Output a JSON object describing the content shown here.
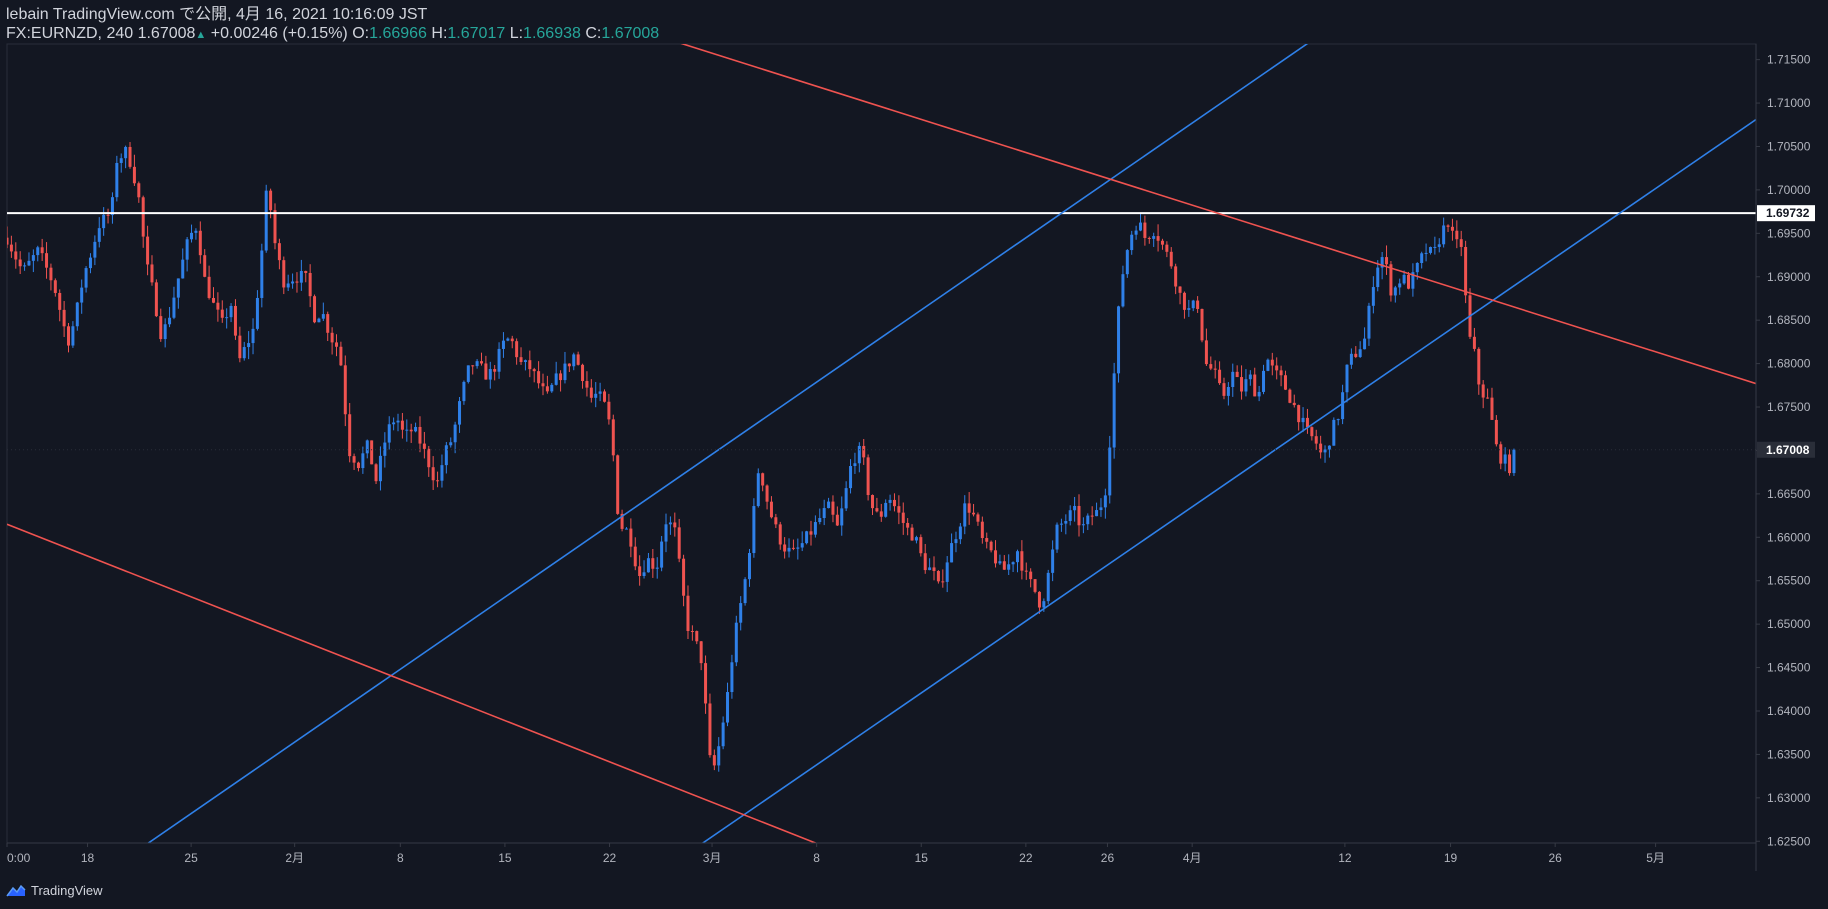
{
  "header": {
    "line1": "lebain TradingView.com で公開, 4月 16, 2021 10:16:09 JST",
    "symbol_info": "FX:EURNZD, 240 1.67008",
    "change_arrow": "▲",
    "change": "+0.00246 (+0.15%)",
    "o_label": "O:",
    "o_value": "1.66966",
    "h_label": "H:",
    "h_value": "1.67017",
    "l_label": "L:",
    "l_value": "1.66938",
    "c_label": "C:",
    "c_value": "1.67008"
  },
  "footer": {
    "brand": "TradingView",
    "logo_icon": "tradingview-logo-icon"
  },
  "colors": {
    "background": "#131722",
    "up": "#2f80e8",
    "down": "#ef5350",
    "trend_blue": "#2f80e8",
    "trend_red": "#ef5350",
    "axis_text": "#b2b5be",
    "axis_line": "#363a45",
    "price_up_text": "#26a69a"
  },
  "chart_data": {
    "type": "candlestick",
    "symbol": "FX:EURNZD",
    "interval": "240",
    "y_axis": {
      "position": "right",
      "ylim": [
        1.6248,
        1.7168
      ],
      "ticks": [
        "1.71500",
        "1.71000",
        "1.70500",
        "1.70000",
        "1.69500",
        "1.69000",
        "1.68500",
        "1.68000",
        "1.67500",
        "1.67000",
        "1.66500",
        "1.66000",
        "1.65500",
        "1.65000",
        "1.64500",
        "1.64000",
        "1.63500",
        "1.63000",
        "1.62500"
      ]
    },
    "x_axis": {
      "ticks": [
        {
          "label": "0:00",
          "x": 0.0
        },
        {
          "label": "18",
          "x": 7.7
        },
        {
          "label": "25",
          "x": 17.6
        },
        {
          "label": "2月",
          "x": 27.5
        },
        {
          "label": "8",
          "x": 37.6
        },
        {
          "label": "15",
          "x": 47.6
        },
        {
          "label": "22",
          "x": 57.6
        },
        {
          "label": "3月",
          "x": 67.4
        },
        {
          "label": "8",
          "x": 77.4
        },
        {
          "label": "15",
          "x": 87.4
        },
        {
          "label": "22",
          "x": 97.4
        },
        {
          "label": "26",
          "x": 105.2
        },
        {
          "label": "4月",
          "x": 113.3
        },
        {
          "label": "12",
          "x": 127.9
        },
        {
          "label": "19",
          "x": 138.0
        },
        {
          "label": "26",
          "x": 148.0
        },
        {
          "label": "5月",
          "x": 157.6
        }
      ],
      "xlim": [
        0,
        167.2
      ]
    },
    "price_markers": [
      {
        "label": "1.69732",
        "value": 1.69732,
        "style": "white"
      },
      {
        "label": "1.67008",
        "value": 1.67008,
        "style": "current"
      }
    ],
    "horizontal_lines": [
      {
        "value": 1.69732,
        "color": "#ffffff"
      }
    ],
    "trendlines": [
      {
        "color": "#2f80e8",
        "from": {
          "x": 13.4,
          "y": 1.6247
        },
        "to": {
          "x": 124.5,
          "y": 1.717
        }
      },
      {
        "color": "#2f80e8",
        "from": {
          "x": 66.4,
          "y": 1.6247
        },
        "to": {
          "x": 167.2,
          "y": 1.7081
        }
      },
      {
        "color": "#ef5350",
        "from": {
          "x": 64.1,
          "y": 1.717
        },
        "to": {
          "x": 167.2,
          "y": 1.6777
        }
      },
      {
        "color": "#ef5350",
        "from": {
          "x": 0.0,
          "y": 1.6615
        },
        "to": {
          "x": 77.5,
          "y": 1.6247
        }
      }
    ],
    "close_path": [
      [
        0,
        1.6945
      ],
      [
        1.5,
        1.6905
      ],
      [
        3,
        1.693
      ],
      [
        4.5,
        1.689
      ],
      [
        5.8,
        1.6825
      ],
      [
        6.5,
        1.685
      ],
      [
        7.3,
        1.69
      ],
      [
        8.1,
        1.693
      ],
      [
        8.8,
        1.696
      ],
      [
        10,
        1.6975
      ],
      [
        10.5,
        1.7035
      ],
      [
        11.5,
        1.7045
      ],
      [
        12.5,
        1.7
      ],
      [
        13.3,
        1.6915
      ],
      [
        14,
        1.688
      ],
      [
        14.8,
        1.683
      ],
      [
        15.5,
        1.6855
      ],
      [
        16.2,
        1.689
      ],
      [
        17.4,
        1.6945
      ],
      [
        18.2,
        1.696
      ],
      [
        18.8,
        1.69
      ],
      [
        19.8,
        1.6865
      ],
      [
        20.6,
        1.6845
      ],
      [
        21.4,
        1.687
      ],
      [
        22.1,
        1.68
      ],
      [
        23.6,
        1.684
      ],
      [
        24.4,
        1.6935
      ],
      [
        24.9,
        1.701
      ],
      [
        25.5,
        1.6945
      ],
      [
        26.4,
        1.6895
      ],
      [
        27.6,
        1.69
      ],
      [
        28.5,
        1.69
      ],
      [
        29.4,
        1.6855
      ],
      [
        30.1,
        1.686
      ],
      [
        31,
        1.683
      ],
      [
        31.8,
        1.6815
      ],
      [
        32.7,
        1.67
      ],
      [
        33.6,
        1.6685
      ],
      [
        34.5,
        1.6705
      ],
      [
        35.3,
        1.6665
      ],
      [
        36.3,
        1.672
      ],
      [
        37.2,
        1.674
      ],
      [
        38,
        1.6715
      ],
      [
        38.8,
        1.6725
      ],
      [
        39.5,
        1.671
      ],
      [
        40.5,
        1.668
      ],
      [
        41.1,
        1.666
      ],
      [
        41.8,
        1.6695
      ],
      [
        42.6,
        1.6715
      ],
      [
        43.5,
        1.6765
      ],
      [
        44.3,
        1.68
      ],
      [
        45.2,
        1.6795
      ],
      [
        46,
        1.6785
      ],
      [
        46.8,
        1.68
      ],
      [
        47.3,
        1.682
      ],
      [
        48.1,
        1.683
      ],
      [
        49.1,
        1.68
      ],
      [
        50,
        1.6795
      ],
      [
        50.7,
        1.678
      ],
      [
        51.6,
        1.676
      ],
      [
        52.4,
        1.678
      ],
      [
        53.4,
        1.6795
      ],
      [
        54.2,
        1.681
      ],
      [
        55.1,
        1.6785
      ],
      [
        55.8,
        1.676
      ],
      [
        56.5,
        1.6765
      ],
      [
        57.4,
        1.6745
      ],
      [
        58,
        1.669
      ],
      [
        58.5,
        1.6615
      ],
      [
        59.5,
        1.6605
      ],
      [
        60.4,
        1.6555
      ],
      [
        61.2,
        1.6575
      ],
      [
        62.1,
        1.6565
      ],
      [
        62.9,
        1.662
      ],
      [
        63.8,
        1.661
      ],
      [
        64.4,
        1.6555
      ],
      [
        65,
        1.65
      ],
      [
        65.8,
        1.648
      ],
      [
        66.5,
        1.6455
      ],
      [
        67.1,
        1.6345
      ],
      [
        67.7,
        1.6335
      ],
      [
        68.2,
        1.637
      ],
      [
        68.9,
        1.642
      ],
      [
        69.5,
        1.648
      ],
      [
        70.1,
        1.652
      ],
      [
        70.7,
        1.656
      ],
      [
        71.4,
        1.663
      ],
      [
        71.9,
        1.6685
      ],
      [
        72.5,
        1.665
      ],
      [
        73.3,
        1.6615
      ],
      [
        74.2,
        1.659
      ],
      [
        75.1,
        1.658
      ],
      [
        75.9,
        1.659
      ],
      [
        76.8,
        1.6605
      ],
      [
        77.6,
        1.662
      ],
      [
        78.5,
        1.6635
      ],
      [
        79.4,
        1.661
      ],
      [
        80,
        1.664
      ],
      [
        80.8,
        1.669
      ],
      [
        81.7,
        1.67
      ],
      [
        82.5,
        1.664
      ],
      [
        83.4,
        1.662
      ],
      [
        84.2,
        1.665
      ],
      [
        85.1,
        1.663
      ],
      [
        86,
        1.661
      ],
      [
        86.8,
        1.66
      ],
      [
        87.6,
        1.657
      ],
      [
        88.5,
        1.656
      ],
      [
        89.1,
        1.654
      ],
      [
        90,
        1.658
      ],
      [
        90.9,
        1.661
      ],
      [
        91.7,
        1.664
      ],
      [
        92.6,
        1.662
      ],
      [
        93.4,
        1.659
      ],
      [
        94.3,
        1.658
      ],
      [
        95.1,
        1.656
      ],
      [
        95.9,
        1.657
      ],
      [
        96.6,
        1.6585
      ],
      [
        97.4,
        1.6555
      ],
      [
        98.2,
        1.654
      ],
      [
        98.9,
        1.652
      ],
      [
        99.6,
        1.656
      ],
      [
        100.4,
        1.661
      ],
      [
        101.2,
        1.662
      ],
      [
        102,
        1.663
      ],
      [
        102.8,
        1.661
      ],
      [
        103.7,
        1.6625
      ],
      [
        104.4,
        1.663
      ],
      [
        105.1,
        1.666
      ],
      [
        105.6,
        1.674
      ],
      [
        106.1,
        1.684
      ],
      [
        106.6,
        1.69
      ],
      [
        107.3,
        1.6945
      ],
      [
        108.1,
        1.6965
      ],
      [
        108.8,
        1.6945
      ],
      [
        109.7,
        1.6955
      ],
      [
        110.5,
        1.6935
      ],
      [
        111.3,
        1.6915
      ],
      [
        112.1,
        1.688
      ],
      [
        112.9,
        1.686
      ],
      [
        113.8,
        1.687
      ],
      [
        114.6,
        1.68
      ],
      [
        115.4,
        1.679
      ],
      [
        116.2,
        1.676
      ],
      [
        117.1,
        1.679
      ],
      [
        118,
        1.677
      ],
      [
        118.8,
        1.6785
      ],
      [
        119.6,
        1.676
      ],
      [
        120.3,
        1.681
      ],
      [
        121.1,
        1.679
      ],
      [
        121.9,
        1.678
      ],
      [
        122.7,
        1.676
      ],
      [
        123.5,
        1.674
      ],
      [
        124.3,
        1.672
      ],
      [
        125.1,
        1.671
      ],
      [
        125.8,
        1.669
      ],
      [
        126.6,
        1.672
      ],
      [
        127.4,
        1.6745
      ],
      [
        128.2,
        1.68
      ],
      [
        129.1,
        1.6815
      ],
      [
        129.9,
        1.683
      ],
      [
        130.3,
        1.687
      ],
      [
        130.8,
        1.691
      ],
      [
        131.6,
        1.6925
      ],
      [
        132.4,
        1.688
      ],
      [
        133.3,
        1.69
      ],
      [
        134.1,
        1.689
      ],
      [
        134.8,
        1.691
      ],
      [
        135.6,
        1.693
      ],
      [
        136.4,
        1.6925
      ],
      [
        137.1,
        1.695
      ],
      [
        137.8,
        1.6965
      ],
      [
        138.4,
        1.6935
      ],
      [
        139,
        1.694
      ],
      [
        139.4,
        1.688
      ],
      [
        139.8,
        1.683
      ],
      [
        140.3,
        1.681
      ],
      [
        140.8,
        1.677
      ],
      [
        141.5,
        1.676
      ],
      [
        142,
        1.673
      ],
      [
        142.5,
        1.6695
      ],
      [
        143.1,
        1.669
      ],
      [
        143.6,
        1.668
      ],
      [
        144.2,
        1.67008
      ]
    ]
  }
}
